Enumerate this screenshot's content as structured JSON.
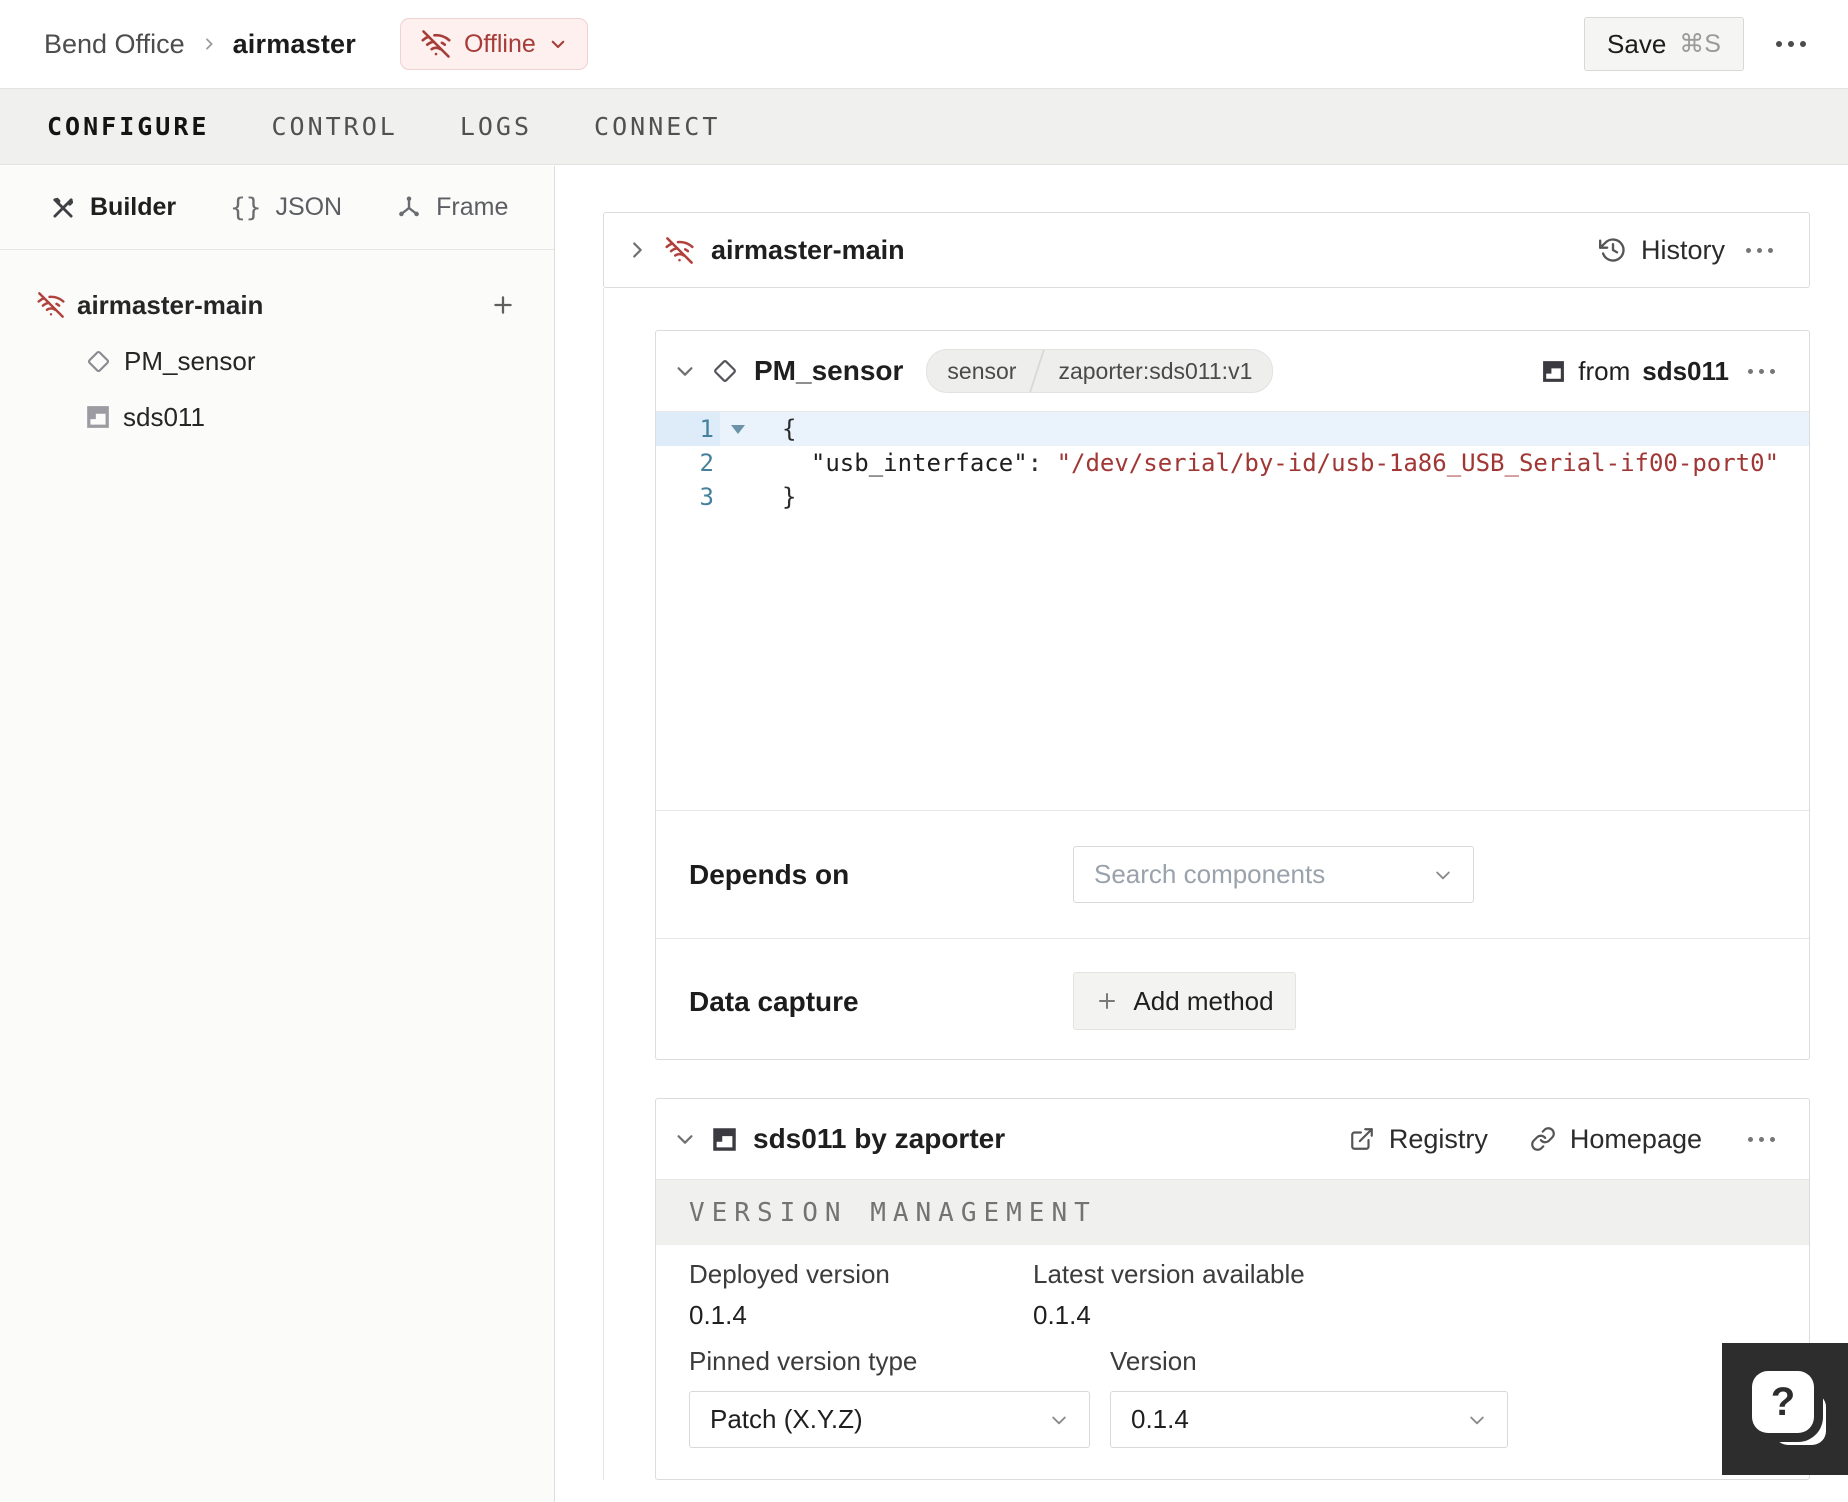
{
  "header": {
    "breadcrumb": {
      "location": "Bend Office",
      "machine": "airmaster"
    },
    "status_badge": {
      "label": "Offline"
    },
    "save_button": {
      "label": "Save",
      "shortcut": "⌘S"
    }
  },
  "tabs": {
    "items": [
      {
        "label": "CONFIGURE",
        "active": true
      },
      {
        "label": "CONTROL",
        "active": false
      },
      {
        "label": "LOGS",
        "active": false
      },
      {
        "label": "CONNECT",
        "active": false
      }
    ]
  },
  "sidebar": {
    "modes": [
      {
        "label": "Builder",
        "icon": "tools-icon",
        "active": true
      },
      {
        "label": "JSON",
        "icon": "braces-icon",
        "active": false
      },
      {
        "label": "Frame",
        "icon": "frame-axes-icon",
        "active": false
      }
    ],
    "tree": [
      {
        "label": "airmaster-main",
        "icon": "offline-icon"
      },
      {
        "label": "PM_sensor",
        "icon": "diamond-icon"
      },
      {
        "label": "sds011",
        "icon": "module-icon"
      }
    ]
  },
  "main": {
    "part_card": {
      "title": "airmaster-main",
      "history_label": "History"
    },
    "component_card": {
      "title": "PM_sensor",
      "badges": {
        "type": "sensor",
        "model": "zaporter:sds011:v1"
      },
      "from_prefix": "from",
      "from_module": "sds011",
      "code": {
        "lines": [
          {
            "num": "1",
            "fold": true,
            "highlight": true,
            "tokens": [
              {
                "t": "plain",
                "v": "{"
              }
            ]
          },
          {
            "num": "2",
            "tokens": [
              {
                "t": "plain",
                "v": "  "
              },
              {
                "t": "key",
                "v": "\"usb_interface\""
              },
              {
                "t": "plain",
                "v": ": "
              },
              {
                "t": "string",
                "v": "\"/dev/serial/by-id/usb-1a86_USB_Serial-if00-port0\""
              }
            ]
          },
          {
            "num": "3",
            "tokens": [
              {
                "t": "plain",
                "v": "}"
              }
            ]
          }
        ]
      },
      "depends_on": {
        "label": "Depends on",
        "placeholder": "Search components"
      },
      "data_capture": {
        "label": "Data capture",
        "add_button": "Add method"
      }
    },
    "module_card": {
      "title": "sds011 by zaporter",
      "registry_label": "Registry",
      "homepage_label": "Homepage",
      "section_title": "VERSION MANAGEMENT",
      "deployed": {
        "label": "Deployed version",
        "value": "0.1.4"
      },
      "latest": {
        "label": "Latest version available",
        "value": "0.1.4"
      },
      "pinned_type": {
        "label": "Pinned version type",
        "value": "Patch (X.Y.Z)"
      },
      "version": {
        "label": "Version",
        "value": "0.1.4"
      }
    }
  },
  "colors": {
    "accent_red": "#a63d38",
    "offline_badge_bg": "#fdf0ef",
    "tab_bar_bg": "#f0f0ef",
    "code_string": "#a03735",
    "code_line_number": "#45809c",
    "code_line_highlight": "#eaf3fb",
    "help_button_bg": "#2d2d2d"
  }
}
